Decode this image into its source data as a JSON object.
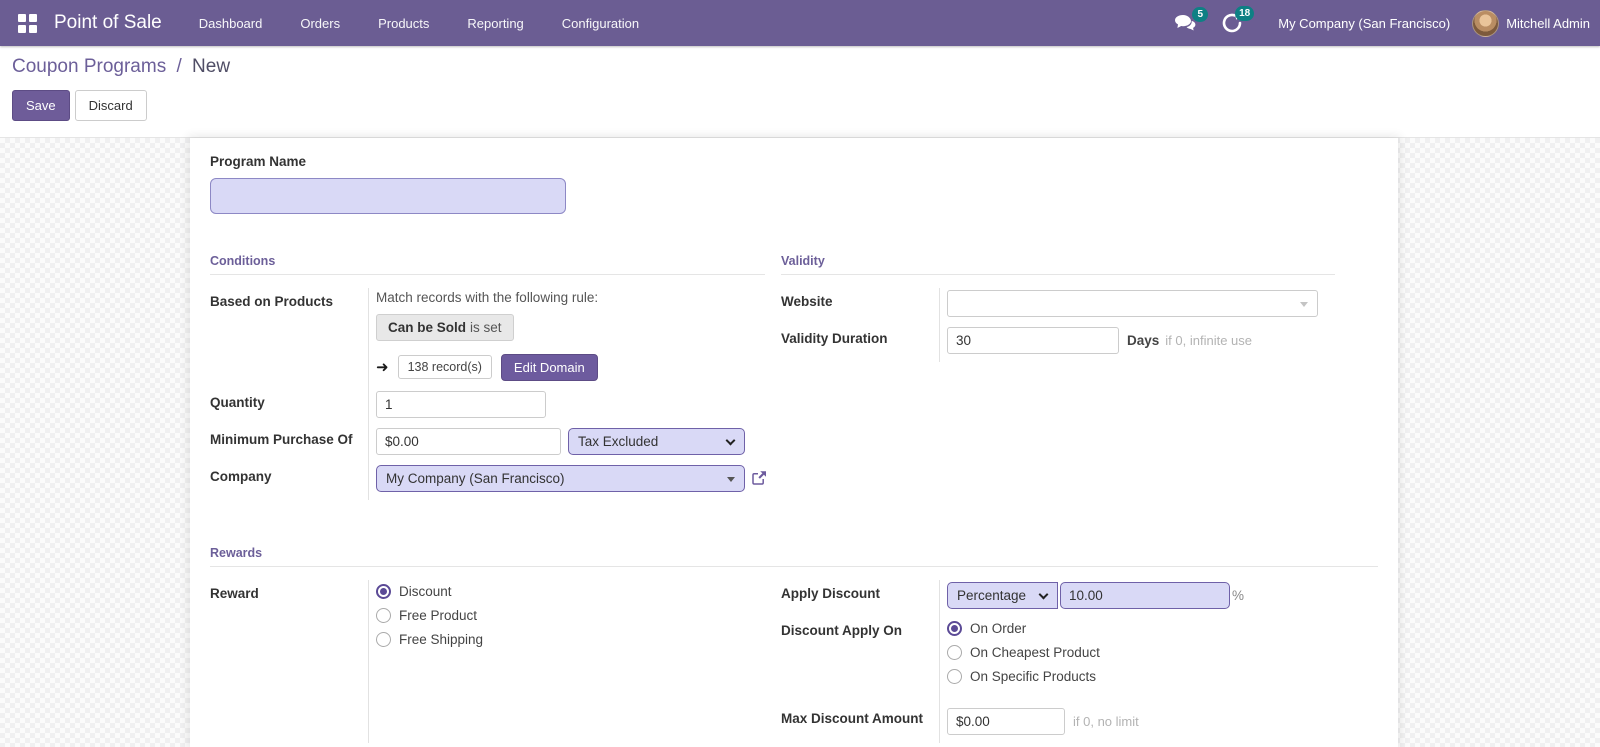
{
  "navbar": {
    "brand": "Point of Sale",
    "menus": [
      "Dashboard",
      "Orders",
      "Products",
      "Reporting",
      "Configuration"
    ],
    "messages_badge": "5",
    "activities_badge": "18",
    "company": "My Company (San Francisco)",
    "user": "Mitchell Admin"
  },
  "breadcrumb": {
    "parent": "Coupon Programs",
    "separator": "/",
    "current": "New"
  },
  "actions": {
    "save": "Save",
    "discard": "Discard"
  },
  "form": {
    "program_name": {
      "label": "Program Name",
      "value": ""
    },
    "conditions": {
      "title": "Conditions",
      "based_on_products": {
        "label": "Based on Products",
        "rule_text": "Match records with the following rule:",
        "rule_field": "Can be Sold",
        "rule_operator": "is set",
        "records_count": "138 record(s)",
        "edit_domain": "Edit Domain",
        "arrow": "➜"
      },
      "quantity": {
        "label": "Quantity",
        "value": "1"
      },
      "minimum_purchase": {
        "label": "Minimum Purchase Of",
        "value": "$0.00",
        "tax_mode": "Tax Excluded"
      },
      "company": {
        "label": "Company",
        "value": "My Company (San Francisco)"
      }
    },
    "validity": {
      "title": "Validity",
      "website": {
        "label": "Website",
        "value": ""
      },
      "validity_duration": {
        "label": "Validity Duration",
        "value": "30",
        "unit": "Days",
        "hint": "if 0, infinite use"
      }
    },
    "rewards": {
      "title": "Rewards",
      "reward": {
        "label": "Reward",
        "options": [
          "Discount",
          "Free Product",
          "Free Shipping"
        ],
        "selected": "Discount"
      },
      "apply_discount": {
        "label": "Apply Discount",
        "type": "Percentage",
        "value": "10.00",
        "suffix": "%"
      },
      "discount_apply_on": {
        "label": "Discount Apply On",
        "options": [
          "On Order",
          "On Cheapest Product",
          "On Specific Products"
        ],
        "selected": "On Order"
      },
      "max_discount": {
        "label": "Max Discount Amount",
        "value": "$0.00",
        "hint": "if 0, no limit"
      }
    }
  },
  "colors": {
    "navbar_bg": "#6b5d93",
    "badge_teal": "#0e8084",
    "primary_purple": "#6e5c99",
    "lavender_field": "#d9d9f6",
    "section_title": "#6c5f99"
  }
}
